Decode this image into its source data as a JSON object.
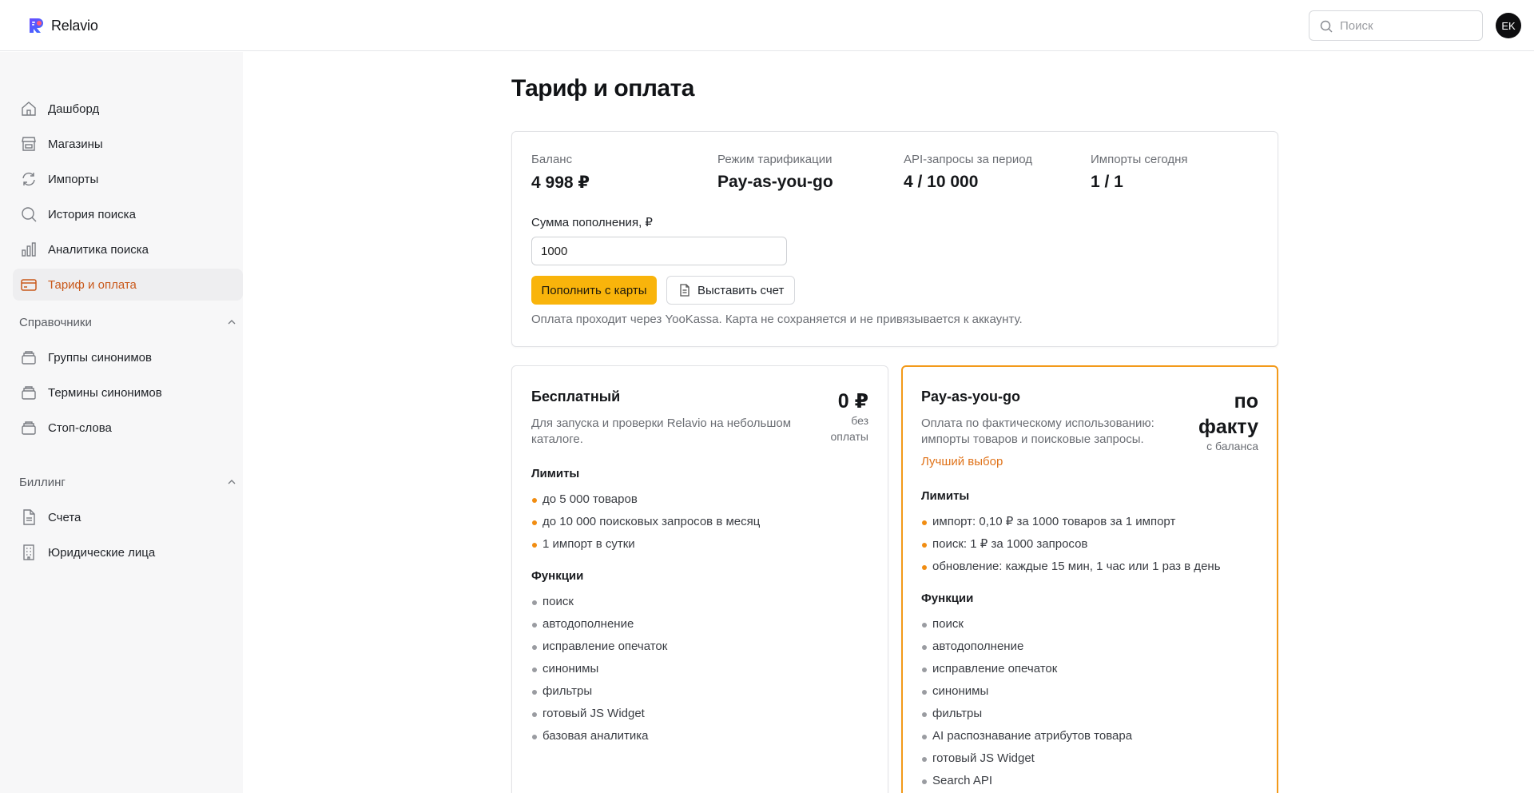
{
  "app": {
    "name": "Relavio",
    "search_placeholder": "Поиск",
    "user_initials": "EK"
  },
  "sidebar": {
    "items": [
      {
        "label": "Дашборд",
        "icon": "home-icon"
      },
      {
        "label": "Магазины",
        "icon": "store-icon"
      },
      {
        "label": "Импорты",
        "icon": "refresh-icon"
      },
      {
        "label": "История поиска",
        "icon": "search-icon"
      },
      {
        "label": "Аналитика поиска",
        "icon": "bar-chart-icon"
      },
      {
        "label": "Тариф и оплата",
        "icon": "credit-card-icon",
        "active": true
      }
    ],
    "sections": [
      {
        "title": "Справочники",
        "items": [
          {
            "label": "Группы синонимов",
            "icon": "stack-icon"
          },
          {
            "label": "Термины синонимов",
            "icon": "stack-icon"
          },
          {
            "label": "Стоп-слова",
            "icon": "stack-icon"
          }
        ]
      },
      {
        "title": "Биллинг",
        "items": [
          {
            "label": "Счета",
            "icon": "document-icon"
          },
          {
            "label": "Юридические лица",
            "icon": "building-icon"
          }
        ]
      }
    ]
  },
  "main": {
    "title": "Тариф и оплата",
    "balance": {
      "stats": [
        {
          "label": "Баланс",
          "value": "4 998 ₽"
        },
        {
          "label": "Режим тарификации",
          "value": "Pay-as-you-go"
        },
        {
          "label": "API-запросы за период",
          "value": "4 / 10 000"
        },
        {
          "label": "Импорты сегодня",
          "value": "1 / 1"
        }
      ],
      "topup_label": "Сумма пополнения, ₽",
      "topup_value": "1000",
      "pay_button": "Пополнить с карты",
      "invoice_button": "Выставить счет",
      "note": "Оплата проходит через YooKassa. Карта не сохраняется и не привязывается к аккаунту."
    },
    "plans": [
      {
        "name": "Бесплатный",
        "description": "Для запуска и проверки Relavio на небольшом каталоге.",
        "price": "0 ₽",
        "price_sub_1": "без",
        "price_sub_2": "оплаты",
        "limits_title": "Лимиты",
        "limits": [
          "до 5 000 товаров",
          "до 10 000 поисковых запросов в месяц",
          "1 импорт в сутки"
        ],
        "features_title": "Функции",
        "features": [
          "поиск",
          "автодополнение",
          "исправление опечаток",
          "синонимы",
          "фильтры",
          "готовый JS Widget",
          "базовая аналитика"
        ]
      },
      {
        "name": "Pay-as-you-go",
        "description": "Оплата по фактическому использованию: импорты товаров и поисковые запросы.",
        "price_1": "по",
        "price_2": "факту",
        "price_sub": "с баланса",
        "badge": "Лучший выбор",
        "limits_title": "Лимиты",
        "limits": [
          "импорт: 0,10 ₽ за 1000 товаров за 1 импорт",
          "поиск: 1 ₽ за 1000 запросов",
          "обновление: каждые 15 мин, 1 час или 1 раз в день"
        ],
        "features_title": "Функции",
        "features": [
          "поиск",
          "автодополнение",
          "исправление опечаток",
          "синонимы",
          "фильтры",
          "AI распознавание атрибутов товара",
          "готовый JS Widget",
          "Search API"
        ]
      }
    ]
  },
  "colors": {
    "accent": "#f9b40b",
    "active_nav_text": "#c9581a",
    "highlight_border": "#f39a1a",
    "bullet_limits": "#f18d12"
  }
}
